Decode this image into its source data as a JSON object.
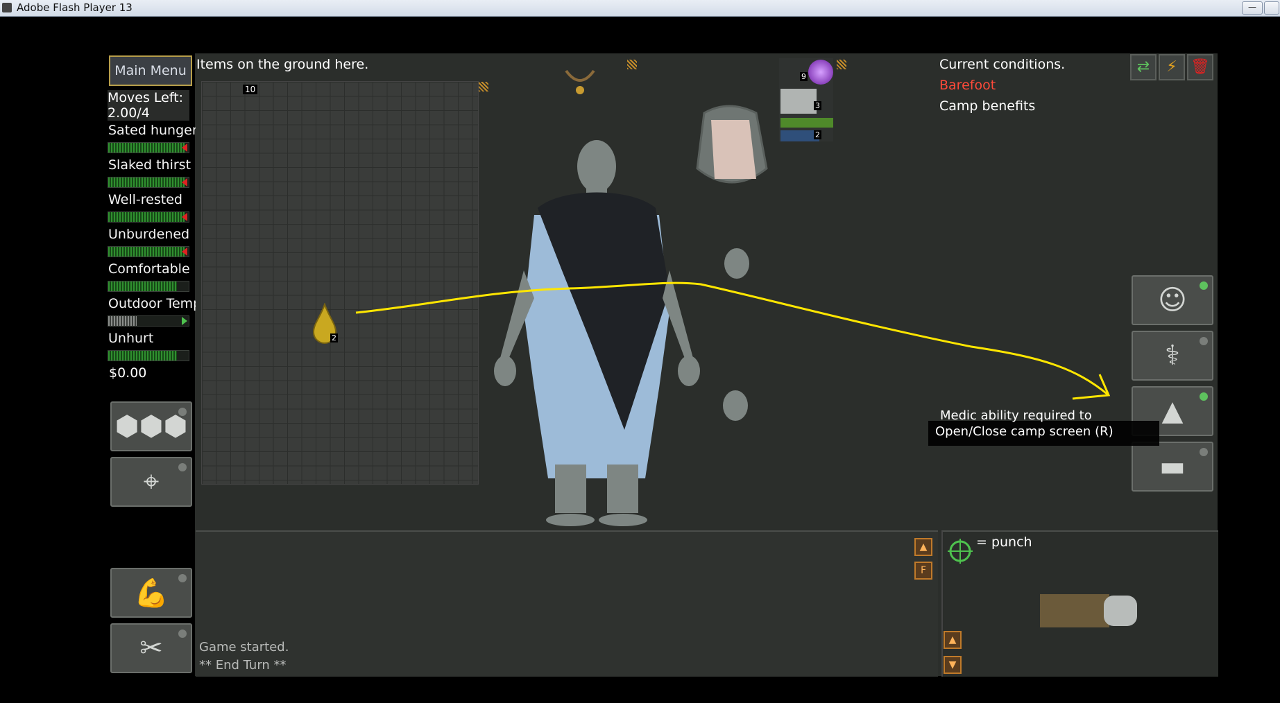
{
  "window": {
    "title": "Adobe Flash Player 13",
    "minimize": "—"
  },
  "sidebar": {
    "main_menu": "Main Menu",
    "moves": {
      "label": "Moves Left:",
      "value": "2.00/4"
    },
    "stats": [
      {
        "label": "Sated hunger",
        "level": 0.95,
        "marker": true
      },
      {
        "label": "Slaked thirst",
        "level": 0.95,
        "marker": true
      },
      {
        "label": "Well-rested",
        "level": 0.95,
        "marker": true
      },
      {
        "label": "Unburdened",
        "level": 0.95,
        "marker": true
      },
      {
        "label": "Comfortable",
        "level": 0.85,
        "marker": false
      },
      {
        "label": "Outdoor Temp",
        "level": 0.35,
        "marker": false
      },
      {
        "label": "Unhurt",
        "level": 0.85,
        "marker": false
      }
    ],
    "money": "$0.00"
  },
  "ground": {
    "title": "Items on the ground here.",
    "count": "10",
    "item_stack": "2"
  },
  "conditions": {
    "title": "Current conditions.",
    "items": [
      {
        "text": "Barefoot",
        "color": "#ff4a3a"
      },
      {
        "text": "Camp benefits",
        "color": "#ffffff"
      }
    ]
  },
  "equipment": {
    "counts": [
      "9",
      "3",
      "2"
    ]
  },
  "tooltip": {
    "line1": "Medic ability required to",
    "line2": "Open/Close camp screen (R)"
  },
  "log": {
    "lines": [
      "Game started.",
      "** End Turn **"
    ]
  },
  "attack": {
    "label": "= punch"
  },
  "colors": {
    "status_green": "#2f8f2f",
    "accent_gold": "#b79e4a",
    "annotation": "#ffe600"
  }
}
